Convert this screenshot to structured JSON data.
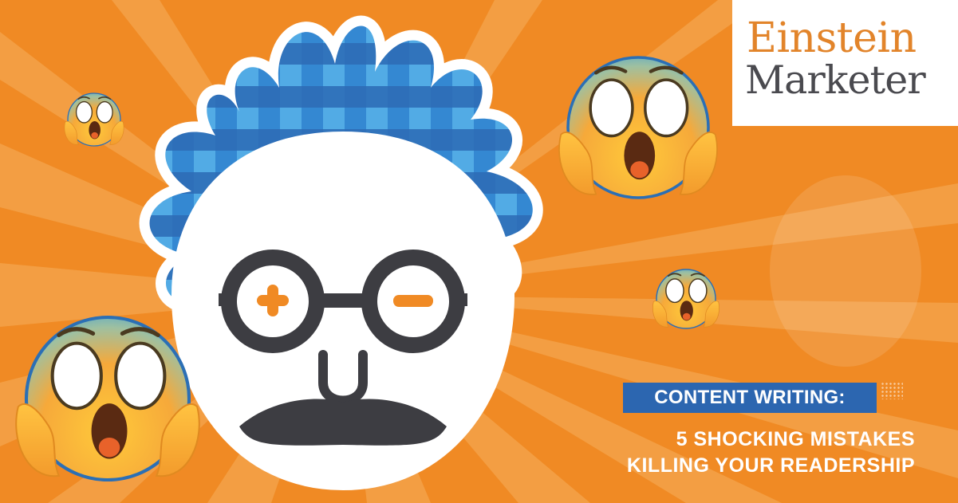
{
  "brand": {
    "logo_line1": "Einstein",
    "logo_line2": "Marketer",
    "orange": "#f08a24",
    "logo_orange": "#e2842a",
    "logo_gray": "#4a4a4f",
    "hair_blue": "#2c66b0",
    "hair_light_blue": "#3f9ddf",
    "glasses_gray": "#3d3d42"
  },
  "headline": {
    "tag": "CONTENT WRITING:",
    "line1": "5 SHOCKING MISTAKES",
    "line2": "KILLING YOUR READERSHIP"
  },
  "illustration": {
    "character": "einstein-face-icon",
    "left_lens_symbol": "+",
    "right_lens_symbol": "−",
    "emoji": "screaming-face-icon",
    "emoji_count": 4
  }
}
